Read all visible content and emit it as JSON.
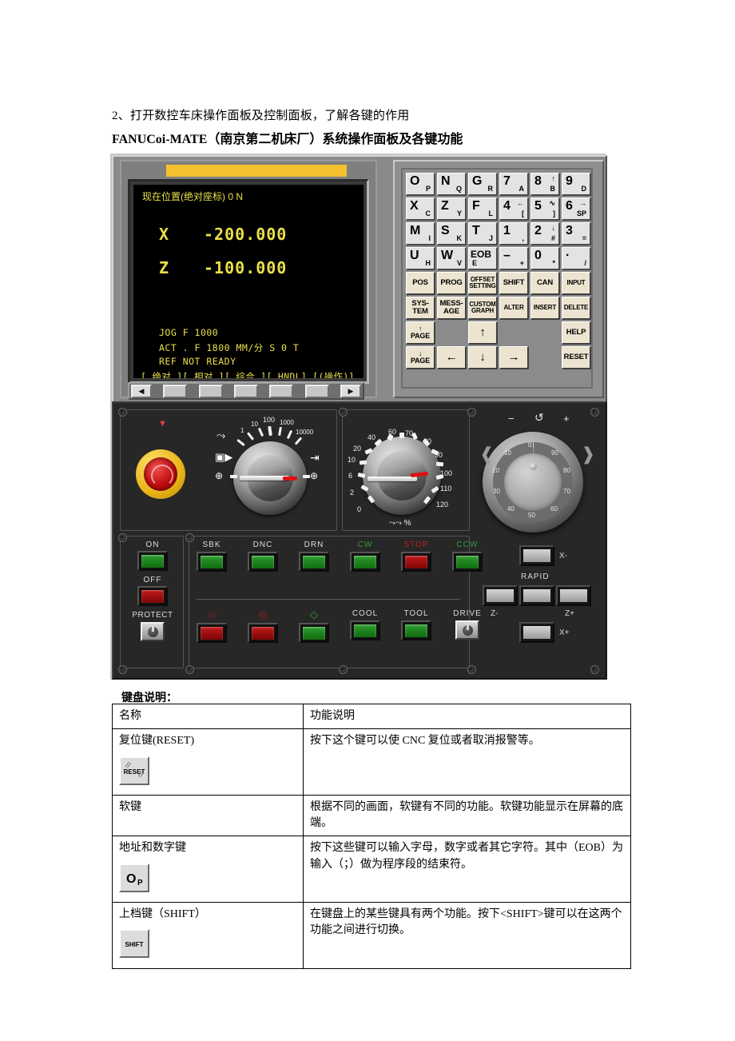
{
  "document": {
    "heading_1": "2、打开数控车床操作面板及控制面板，了解各键的作用",
    "heading_2": "FANUCoi-MATE（南京第二机床厂）系统操作面板及各键功能",
    "table_caption": "键盘说明："
  },
  "crt": {
    "title": "现在位置(绝对座标)    0          N",
    "axis_x_label": "X",
    "axis_x_value": "-200.000",
    "axis_z_label": "Z",
    "axis_z_value": "-100.000",
    "status_line_1": "JOG  F  1000",
    "status_line_2": "ACT . F 1800   MM/分      S  0   T",
    "status_line_3": "REF NOT READY",
    "softkey_line": "[ 绝对 ][ 相对 ][ 综合 ][ HNDL] [(操作)]"
  },
  "softkeys": [
    {
      "name": "softkey-prev",
      "label": "◀"
    },
    {
      "name": "softkey-1",
      "label": ""
    },
    {
      "name": "softkey-2",
      "label": ""
    },
    {
      "name": "softkey-3",
      "label": ""
    },
    {
      "name": "softkey-4",
      "label": ""
    },
    {
      "name": "softkey-5",
      "label": ""
    },
    {
      "name": "softkey-next",
      "label": "▶"
    }
  ],
  "keypad": {
    "alnum_keys": [
      {
        "main": "O",
        "sub": "P"
      },
      {
        "main": "N",
        "sub": "Q"
      },
      {
        "main": "G",
        "sub": "R"
      },
      {
        "main": "7",
        "sub": "A"
      },
      {
        "main": "8",
        "sub": "B",
        "sup": "↑"
      },
      {
        "main": "9",
        "sub": "D"
      },
      {
        "main": "X",
        "sub": "C"
      },
      {
        "main": "Z",
        "sub": "Y"
      },
      {
        "main": "F",
        "sub": "L"
      },
      {
        "main": "4",
        "sub": "[",
        "sup": "←"
      },
      {
        "main": "5",
        "sub": "]",
        "sup": "∿"
      },
      {
        "main": "6",
        "sub": "SP",
        "sup": "→"
      },
      {
        "main": "M",
        "sub": "I"
      },
      {
        "main": "S",
        "sub": "K"
      },
      {
        "main": "T",
        "sub": "J"
      },
      {
        "main": "1",
        "sub": ","
      },
      {
        "main": "2",
        "sub": "#",
        "sup": "↓"
      },
      {
        "main": "3",
        "sub": "="
      },
      {
        "main": "U",
        "sub": "H"
      },
      {
        "main": "W",
        "sub": "V"
      },
      {
        "main": "EOB",
        "sub": "E"
      },
      {
        "main": "–",
        "sub": "+"
      },
      {
        "main": "0",
        "sub": "*"
      },
      {
        "main": "·",
        "sub": "/"
      }
    ],
    "function_keys": [
      "POS",
      "PROG",
      "OFFSET\nSETTING",
      "SHIFT",
      "CAN",
      "INPUT",
      "SYS-\nTEM",
      "MESS-\nAGE",
      "CUSTOM\nGRAPH",
      "ALTER",
      "INSERT",
      "DELETE",
      "↑\nPAGE",
      "",
      "↑",
      "",
      "",
      "HELP",
      "↓\nPAGE",
      "←",
      "↓",
      "→",
      "",
      "RESET"
    ]
  },
  "rapid_dial": {
    "name": "jog-feed-rate-dial",
    "labels": [
      "1",
      "10",
      "100",
      "1000",
      "10000"
    ],
    "left_symbol": "▣▶",
    "right_symbol": "⇥",
    "wave_symbol": "⤳",
    "cross_symbol": "⊕"
  },
  "feed_override_dial": {
    "name": "feedrate-override-dial",
    "labels": [
      "0",
      "2",
      "6",
      "10",
      "20",
      "40",
      "60",
      "70",
      "80",
      "90",
      "100",
      "110",
      "120"
    ],
    "unit_symbol": "⤳⤳ %"
  },
  "handwheel": {
    "name": "manual-pulse-handwheel",
    "minus": "−",
    "plus": "+",
    "center_icon": "↺",
    "scale": [
      "0",
      "10",
      "20",
      "30",
      "40",
      "50",
      "60",
      "70",
      "80",
      "90"
    ]
  },
  "power_column": [
    {
      "name": "machine-on-button",
      "label": "ON",
      "lamp": "green"
    },
    {
      "name": "machine-off-button",
      "label": "OFF",
      "lamp": "red"
    },
    {
      "name": "protect-keyswitch",
      "label": "PROTECT",
      "lamp": "keyswitch"
    }
  ],
  "button_row_top": [
    {
      "name": "single-block-button",
      "label": "SBK",
      "lamp": "green",
      "label_color": "white"
    },
    {
      "name": "dnc-button",
      "label": "DNC",
      "lamp": "green",
      "label_color": "white"
    },
    {
      "name": "dry-run-button",
      "label": "DRN",
      "lamp": "green",
      "label_color": "white"
    },
    {
      "name": "spindle-cw-button",
      "label": "CW",
      "lamp": "green",
      "label_color": "green"
    },
    {
      "name": "spindle-stop-button",
      "label": "STOP",
      "lamp": "red",
      "label_color": "red"
    },
    {
      "name": "spindle-ccw-button",
      "label": "CCW",
      "lamp": "green",
      "label_color": "green"
    }
  ],
  "button_row_bottom": [
    {
      "name": "chip-conveyor-button",
      "label": "",
      "lamp": "red",
      "icon": "slashes"
    },
    {
      "name": "feed-hold-button",
      "label": "",
      "lamp": "red",
      "icon": "stop-circle"
    },
    {
      "name": "cycle-start-button",
      "label": "",
      "lamp": "green",
      "icon": "cycle-start"
    },
    {
      "name": "coolant-button",
      "label": "COOL",
      "lamp": "green"
    },
    {
      "name": "tool-button",
      "label": "TOOL",
      "lamp": "green"
    },
    {
      "name": "drive-keyswitch",
      "label": "DRIVE",
      "lamp": "keyswitch"
    }
  ],
  "jog_pad": {
    "up": {
      "name": "jog-x-minus-button",
      "label": "X-"
    },
    "left": {
      "name": "jog-z-minus-button",
      "label": "Z-"
    },
    "center": {
      "name": "rapid-traverse-button",
      "label": "RAPID"
    },
    "right": {
      "name": "jog-z-plus-button",
      "label": "Z+"
    },
    "down": {
      "name": "jog-x-plus-button",
      "label": "X+"
    }
  },
  "key_table": {
    "headers": [
      "名称",
      "功能说明"
    ],
    "rows": [
      {
        "name": "复位键(RESET)",
        "icon": "reset-key",
        "desc": "按下这个键可以使 CNC 复位或者取消报警等。"
      },
      {
        "name": "软键",
        "icon": "",
        "desc": "根据不同的画面，软键有不同的功能。软键功能显示在屏幕的底端。"
      },
      {
        "name": "地址和数字键",
        "icon": "address-key",
        "desc": "按下这些键可以输入字母，数字或者其它字符。其中（EOB）为输入（；）做为程序段的结束符。"
      },
      {
        "name": "上档键（SHIFT）",
        "icon": "shift-key",
        "desc": "在键盘上的某些键具有两个功能。按下<SHIFT>键可以在这两个功能之间进行切换。"
      }
    ]
  },
  "colors": {
    "crt_text": "#e8e04a",
    "crt_bg": "#000000",
    "panel_metal": "#8a8a8a",
    "panel_dark": "#272727",
    "yellow_bar": "#f5c130",
    "lamp_green": "#2f9e2f",
    "lamp_red": "#c11b1b"
  }
}
